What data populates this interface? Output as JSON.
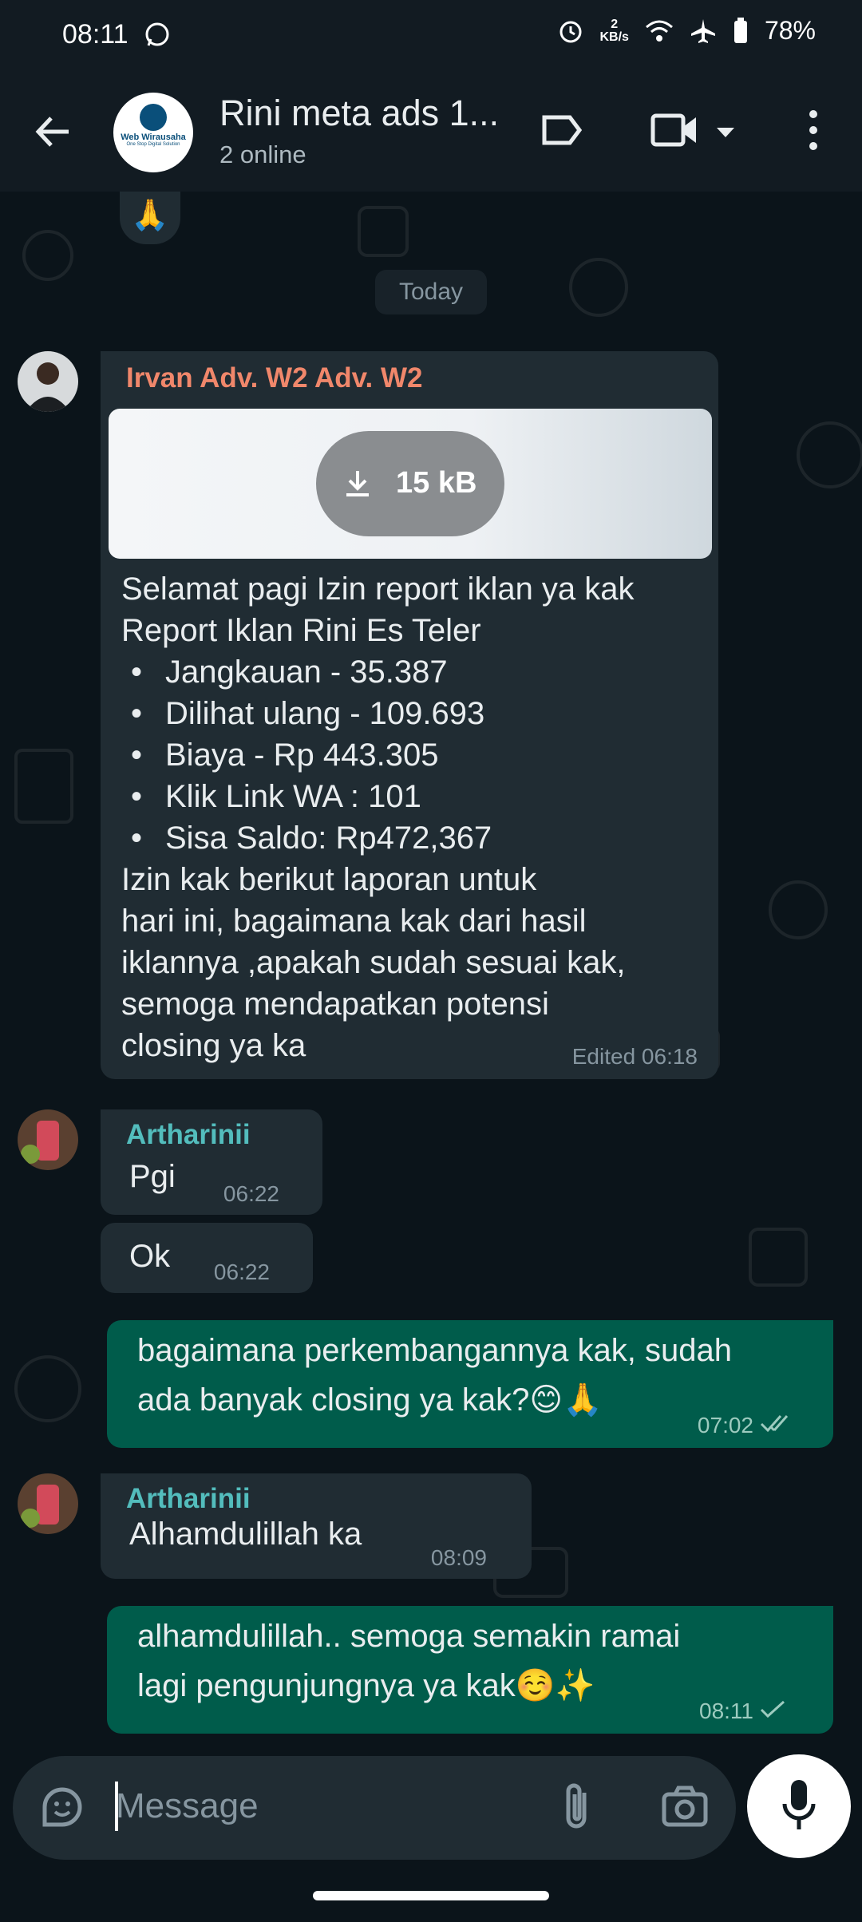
{
  "status_bar": {
    "time": "08:11",
    "network_speed_value": "2",
    "network_speed_unit": "KB/s",
    "battery": "78%"
  },
  "header": {
    "group_name": "Rini meta ads 1...",
    "group_subtitle": "2 online",
    "avatar_text": "Web Wirausaha",
    "avatar_tagline": "One Stop Digital Solution"
  },
  "chat": {
    "prev_reaction": "🙏",
    "date_label": "Today",
    "messages": [
      {
        "sender": "Irvan Adv. W2 Adv. W2",
        "attachment_size": "15 kB",
        "line1": "Selamat pagi Izin report iklan ya kak",
        "line2": "Report Iklan Rini Es Teler",
        "bullets": [
          "Jangkauan - 35.387",
          "Dilihat ulang - 109.693",
          "Biaya - Rp 443.305",
          "Klik Link WA : 101",
          "Sisa Saldo: Rp472,367"
        ],
        "tail_lines": [
          "Izin kak berikut laporan untuk",
          "hari ini, bagaimana kak dari hasil",
          "iklannya ,apakah sudah sesuai kak,",
          "semoga mendapatkan potensi",
          "closing ya ka"
        ],
        "meta": "Edited 06:18"
      },
      {
        "sender": "Artharinii",
        "text": "Pgi",
        "time": "06:22"
      },
      {
        "text": "Ok",
        "time": "06:22"
      },
      {
        "line1": "bagaimana perkembangannya kak, sudah",
        "line2": "ada banyak closing ya kak?😊🙏",
        "time": "07:02"
      },
      {
        "sender": "Artharinii",
        "text": "Alhamdulillah ka",
        "time": "08:09"
      },
      {
        "line1": "alhamdulillah.. semoga semakin ramai",
        "line2": "lagi pengunjungnya ya kak☺️✨",
        "time": "08:11"
      }
    ]
  },
  "composer": {
    "placeholder": "Message"
  },
  "colors": {
    "background": "#0b141a",
    "incoming_bubble": "#202c33",
    "outgoing_bubble": "#005c4b",
    "irvan_name": "#f0876b",
    "artharinii_name": "#53bdbd"
  }
}
